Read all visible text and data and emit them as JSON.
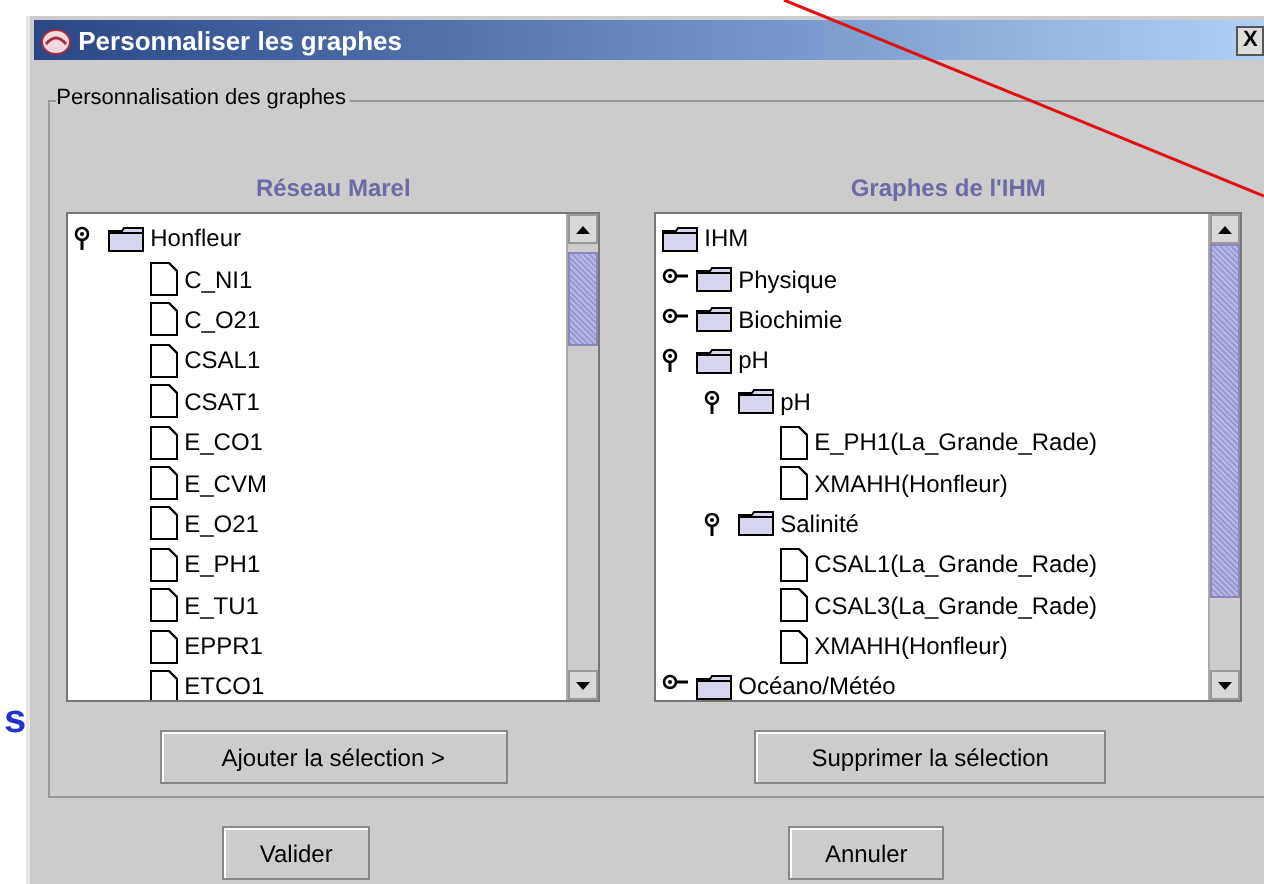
{
  "window": {
    "title": "Personnaliser les graphes",
    "close": "X"
  },
  "backdrop": {
    "text": "s"
  },
  "group": {
    "legend": "Personnalisation des graphes"
  },
  "left": {
    "heading": "Réseau Marel",
    "tree": [
      {
        "kind": "folder",
        "label": "Honfleur",
        "expanded": true,
        "children": [
          {
            "kind": "leaf",
            "label": "C_NI1"
          },
          {
            "kind": "leaf",
            "label": "C_O21"
          },
          {
            "kind": "leaf",
            "label": "CSAL1"
          },
          {
            "kind": "leaf",
            "label": "CSAT1"
          },
          {
            "kind": "leaf",
            "label": "E_CO1"
          },
          {
            "kind": "leaf",
            "label": "E_CVM"
          },
          {
            "kind": "leaf",
            "label": "E_O21"
          },
          {
            "kind": "leaf",
            "label": "E_PH1"
          },
          {
            "kind": "leaf",
            "label": "E_TU1"
          },
          {
            "kind": "leaf",
            "label": "EPPR1"
          },
          {
            "kind": "leaf",
            "label": "ETCO1"
          }
        ]
      }
    ],
    "button": "Ajouter la sélection >"
  },
  "right": {
    "heading": "Graphes de l'IHM",
    "tree": [
      {
        "kind": "root",
        "label": "IHM",
        "children": [
          {
            "kind": "folder",
            "label": "Physique",
            "expanded": false
          },
          {
            "kind": "folder",
            "label": "Biochimie",
            "expanded": false
          },
          {
            "kind": "folder",
            "label": "pH",
            "expanded": true,
            "children": [
              {
                "kind": "folder",
                "label": "pH",
                "expanded": true,
                "children": [
                  {
                    "kind": "leaf",
                    "label": "E_PH1(La_Grande_Rade)"
                  },
                  {
                    "kind": "leaf",
                    "label": "XMAHH(Honfleur)"
                  }
                ]
              },
              {
                "kind": "folder",
                "label": "Salinité",
                "expanded": true,
                "children": [
                  {
                    "kind": "leaf",
                    "label": "CSAL1(La_Grande_Rade)"
                  },
                  {
                    "kind": "leaf",
                    "label": "CSAL3(La_Grande_Rade)"
                  },
                  {
                    "kind": "leaf",
                    "label": "XMAHH(Honfleur)"
                  }
                ]
              }
            ]
          },
          {
            "kind": "folder",
            "label": "Océano/Météo",
            "expanded": false
          }
        ]
      }
    ],
    "button": "Supprimer la sélection"
  },
  "buttons": [
    "Valider",
    "Annuler"
  ]
}
